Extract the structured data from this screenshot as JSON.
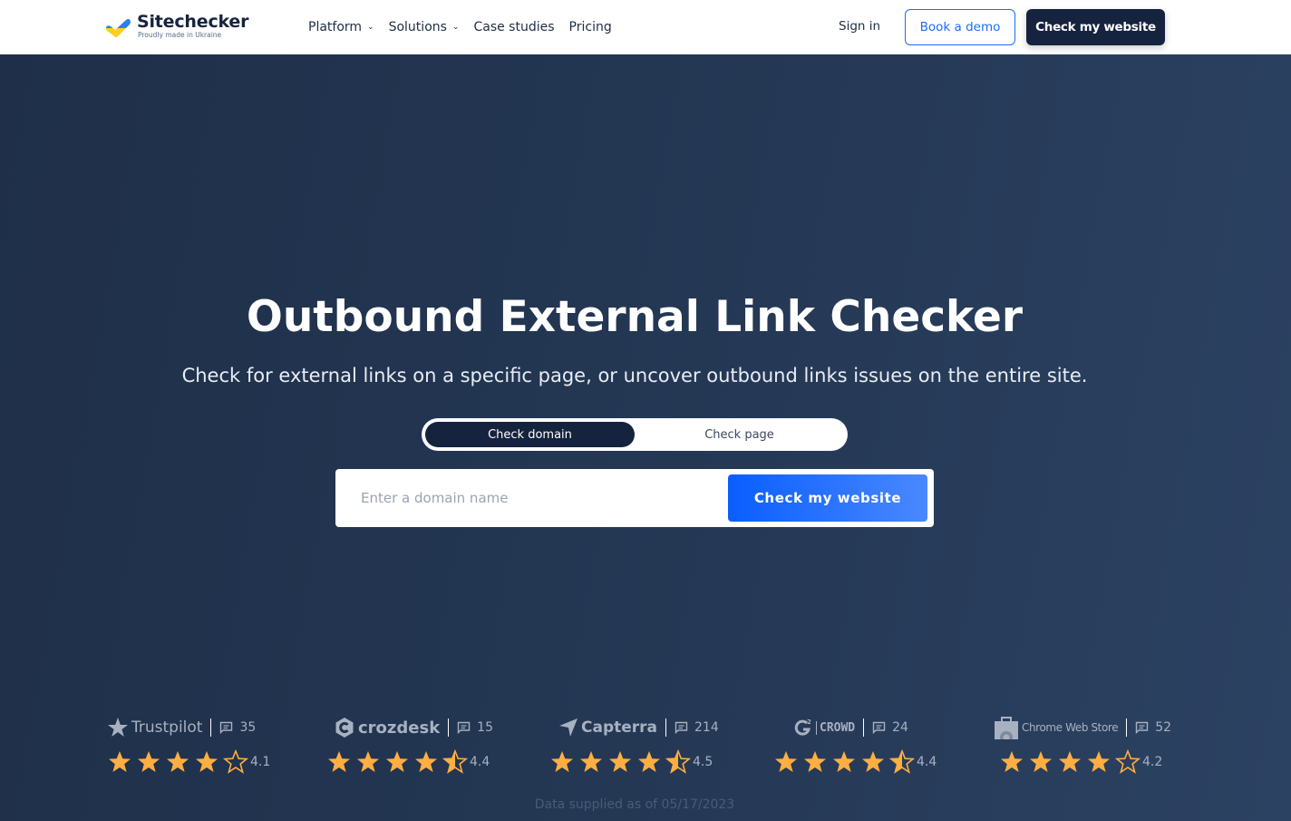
{
  "header": {
    "logo": {
      "name": "Sitechecker",
      "tagline": "Proudly made in Ukraine"
    },
    "nav": [
      {
        "label": "Platform",
        "has_dropdown": true
      },
      {
        "label": "Solutions",
        "has_dropdown": true
      },
      {
        "label": "Case studies",
        "has_dropdown": false
      },
      {
        "label": "Pricing",
        "has_dropdown": false
      }
    ],
    "sign_in": "Sign in",
    "book_demo": "Book a demo",
    "check_website": "Check my website"
  },
  "hero": {
    "title": "Outbound External Link Checker",
    "subtitle": "Check for external links on a specific page, or uncover outbound links issues on the entire site.",
    "toggle": {
      "options": [
        "Check domain",
        "Check page"
      ],
      "selected": "Check domain"
    },
    "search": {
      "placeholder": "Enter a domain name",
      "value": "",
      "button": "Check my website"
    }
  },
  "ratings": [
    {
      "brand": "Trustpilot",
      "reviews": "35",
      "score": "4.1",
      "value": 4.1
    },
    {
      "brand": "crozdesk",
      "reviews": "15",
      "score": "4.4",
      "value": 4.4
    },
    {
      "brand": "Capterra",
      "reviews": "214",
      "score": "4.5",
      "value": 4.5
    },
    {
      "brand": "CROWD",
      "reviews": "24",
      "score": "4.4",
      "value": 4.4
    },
    {
      "brand": "Chrome Web Store",
      "reviews": "52",
      "score": "4.2",
      "value": 4.2
    }
  ],
  "supplied": "Data supplied as of 05/17/2023",
  "colors": {
    "navy": "#16233e",
    "accent_blue": "#1a6dff",
    "star": "#ffae42",
    "muted": "#a7b1c1"
  }
}
